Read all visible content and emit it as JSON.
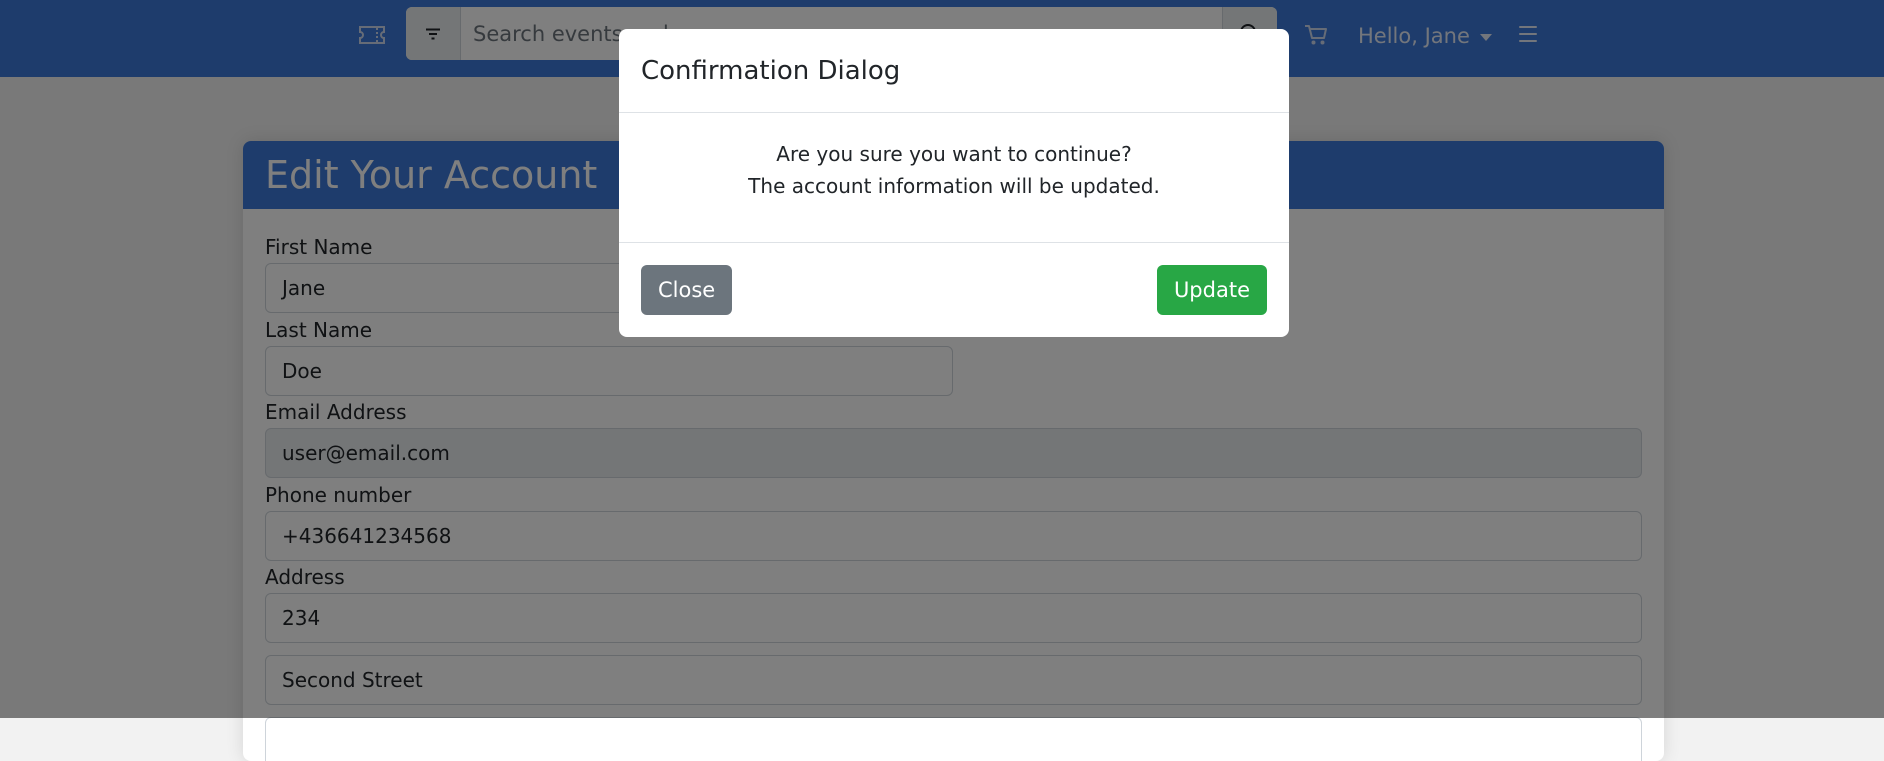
{
  "navbar": {
    "search_placeholder": "Search events and more",
    "user_greeting": "Hello, Jane",
    "icons": [
      "ticket-icon",
      "filter-icon",
      "search-icon",
      "cart-icon",
      "menu-icon"
    ]
  },
  "account_form": {
    "title": "Edit Your Account",
    "first_name_label": "First Name",
    "first_name_value": "Jane",
    "last_name_label": "Last Name",
    "last_name_value": "Doe",
    "email_label": "Email Address",
    "email_value": "user@email.com",
    "phone_label": "Phone number",
    "phone_value": "+436641234568",
    "address_label": "Address",
    "address_line1": "234",
    "address_line2": "Second Street"
  },
  "dialog": {
    "title": "Confirmation Dialog",
    "message_line1": "Are you sure you want to continue?",
    "message_line2": "The account information will be updated.",
    "close_label": "Close",
    "update_label": "Update"
  },
  "colors": {
    "primary": "#3d78d8",
    "secondary": "#6c757d",
    "success": "#28a745"
  }
}
